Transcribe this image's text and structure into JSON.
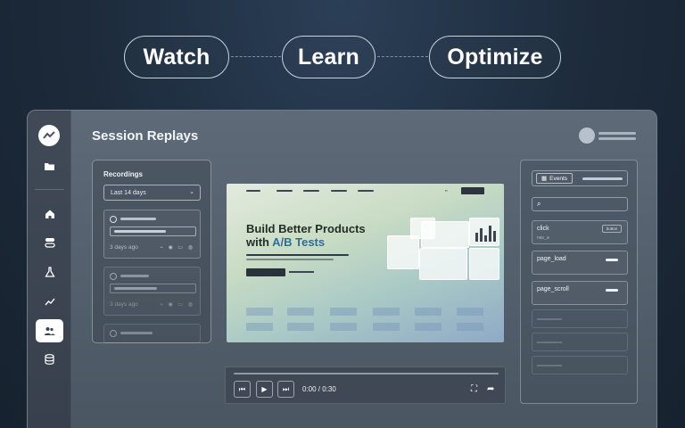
{
  "pills": [
    "Watch",
    "Learn",
    "Optimize"
  ],
  "page": {
    "title": "Session Replays"
  },
  "sidebar": {
    "icons": [
      "folder-icon",
      "home-icon",
      "toggle-icon",
      "flask-icon",
      "trend-icon",
      "users-icon",
      "database-icon"
    ],
    "active": "users-icon"
  },
  "recordings": {
    "title": "Recordings",
    "filter_value": "Last 14 days",
    "cards": [
      {
        "time": "3 days ago"
      },
      {
        "time": "3 days ago"
      }
    ]
  },
  "replay": {
    "headline_line1": "Build Better Products",
    "headline_prefix": "with ",
    "headline_accent": "A/B Tests",
    "accent_color": "#2f6d9e"
  },
  "player": {
    "time": "0:00 / 0:30"
  },
  "events": {
    "tab_label": "Events",
    "items": [
      {
        "name": "click",
        "sub": "nav_a",
        "badge": "button"
      },
      {
        "name": "page_load",
        "sub": "",
        "badge": ""
      },
      {
        "name": "page_scroll",
        "sub": "",
        "badge": ""
      }
    ]
  }
}
